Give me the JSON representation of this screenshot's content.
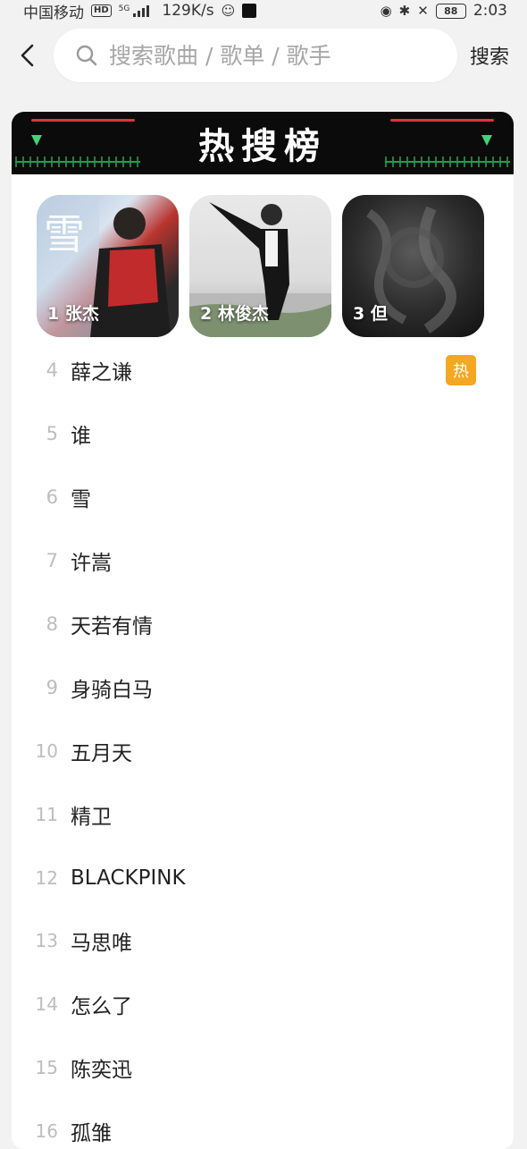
{
  "status_bar": {
    "carrier": "中国移动",
    "hd": "HD",
    "network": "5G",
    "speed": "129K/s",
    "battery": "88",
    "time": "2:03"
  },
  "search": {
    "placeholder": "搜索歌曲 / 歌单 / 歌手",
    "button_label": "搜索"
  },
  "hot": {
    "title": "热搜榜",
    "top3": [
      {
        "rank": "1",
        "name": "张杰"
      },
      {
        "rank": "2",
        "name": "林俊杰"
      },
      {
        "rank": "3",
        "name": "但"
      }
    ],
    "items": [
      {
        "rank": "4",
        "name": "薛之谦",
        "badge": "热"
      },
      {
        "rank": "5",
        "name": "谁"
      },
      {
        "rank": "6",
        "name": "雪"
      },
      {
        "rank": "7",
        "name": "许嵩"
      },
      {
        "rank": "8",
        "name": "天若有情"
      },
      {
        "rank": "9",
        "name": "身骑白马"
      },
      {
        "rank": "10",
        "name": "五月天"
      },
      {
        "rank": "11",
        "name": "精卫"
      },
      {
        "rank": "12",
        "name": "BLACKPINK"
      },
      {
        "rank": "13",
        "name": "马思唯"
      },
      {
        "rank": "14",
        "name": "怎么了"
      },
      {
        "rank": "15",
        "name": "陈奕迅"
      },
      {
        "rank": "16",
        "name": "孤雏"
      }
    ]
  },
  "colors": {
    "badge": "#f5a623",
    "banner_bg": "#0b0b0b",
    "banner_red": "#e0333f",
    "banner_green": "#3fd47a"
  }
}
